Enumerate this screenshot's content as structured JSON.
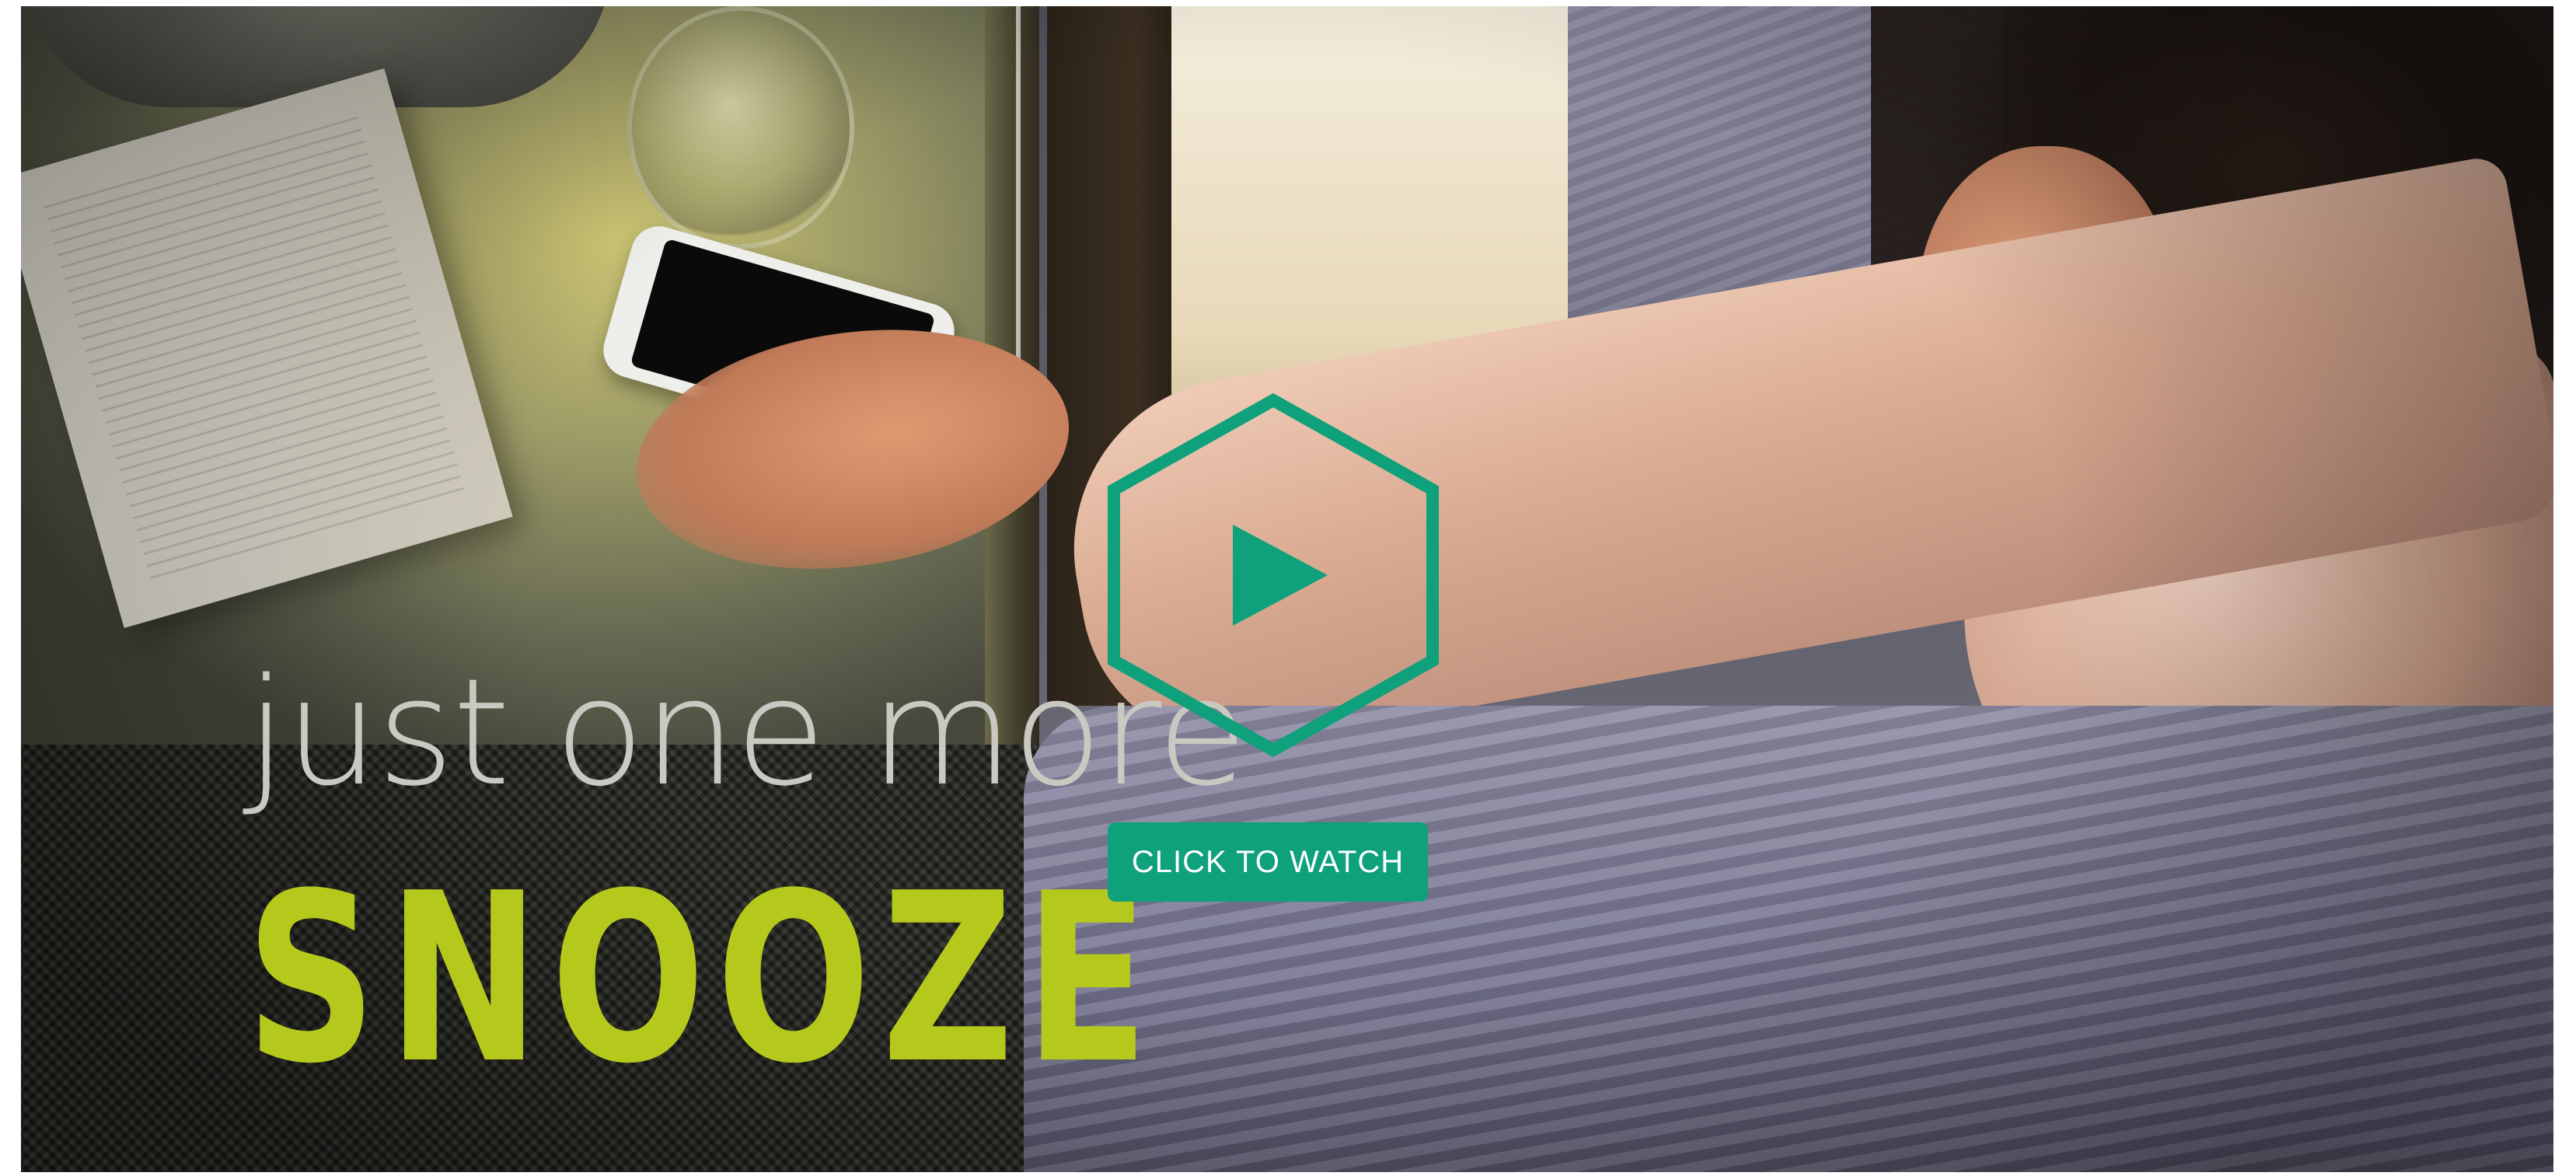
{
  "hero": {
    "tagline": "just one more",
    "headline": "SNOOZE",
    "play_icon": "play-icon",
    "cta_label": "CLICK TO WATCH"
  },
  "colors": {
    "accent": "#0fa07c",
    "headline": "#b5c91c",
    "tagline": "#c9c9c2"
  }
}
